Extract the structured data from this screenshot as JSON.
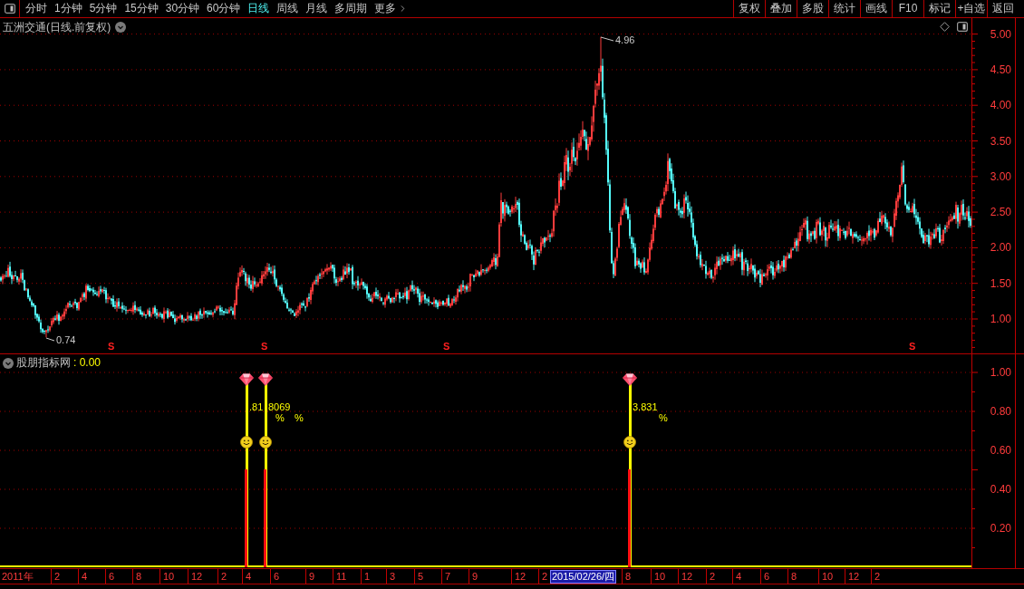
{
  "toolbar": {
    "periods": [
      {
        "label": "分时",
        "kind": "period",
        "selected": false
      },
      {
        "label": "1分钟",
        "kind": "period",
        "selected": false
      },
      {
        "label": "5分钟",
        "kind": "period",
        "selected": false
      },
      {
        "label": "15分钟",
        "kind": "period",
        "selected": false
      },
      {
        "label": "30分钟",
        "kind": "period",
        "selected": false
      },
      {
        "label": "60分钟",
        "kind": "period",
        "selected": false
      },
      {
        "label": "日线",
        "kind": "period",
        "selected": true
      },
      {
        "label": "周线",
        "kind": "period",
        "selected": false
      },
      {
        "label": "月线",
        "kind": "period",
        "selected": false
      },
      {
        "label": "多周期",
        "kind": "period",
        "selected": false
      },
      {
        "label": "更多",
        "kind": "menu",
        "selected": false
      }
    ],
    "actions": [
      "复权",
      "叠加",
      "多股",
      "统计",
      "画线",
      "F10",
      "标记",
      "+自选",
      "返回"
    ]
  },
  "price_panel": {
    "title": "五洲交通(日线.前复权)",
    "high_label": "4.96",
    "low_label": "0.74",
    "signals": [
      "S",
      "S",
      "S",
      "S"
    ],
    "axis_labels": [
      "5.00",
      "4.50",
      "4.00",
      "3.50",
      "3.00",
      "2.50",
      "2.00",
      "1.50",
      "1.00"
    ]
  },
  "indicator_panel": {
    "name": "股朋指标网",
    "reading": ": 0.00",
    "markers": [
      {
        "label": ".81",
        "unit": "%"
      },
      {
        "label": "8069",
        "unit": "%"
      },
      {
        "label": "3.831",
        "unit": "%"
      }
    ],
    "axis_labels": [
      "1.00",
      "0.80",
      "0.60",
      "0.40",
      "0.20"
    ]
  },
  "time_axis": [
    {
      "label": "2011年",
      "kind": "tick"
    },
    {
      "label": "2",
      "kind": "tick"
    },
    {
      "label": "4",
      "kind": "tick"
    },
    {
      "label": "6",
      "kind": "tick"
    },
    {
      "label": "8",
      "kind": "tick"
    },
    {
      "label": "10",
      "kind": "tick"
    },
    {
      "label": "12",
      "kind": "tick"
    },
    {
      "label": "2",
      "kind": "tick"
    },
    {
      "label": "4",
      "kind": "tick"
    },
    {
      "label": "6",
      "kind": "tick"
    },
    {
      "label": "9",
      "kind": "tick"
    },
    {
      "label": "11",
      "kind": "tick"
    },
    {
      "label": "1",
      "kind": "tick"
    },
    {
      "label": "3",
      "kind": "tick"
    },
    {
      "label": "5",
      "kind": "tick"
    },
    {
      "label": "7",
      "kind": "tick"
    },
    {
      "label": "9",
      "kind": "tick"
    },
    {
      "label": "12",
      "kind": "tick"
    },
    {
      "label": "2",
      "kind": "tick"
    },
    {
      "label": "2015/02/26/四",
      "kind": "cursor"
    },
    {
      "label": "8",
      "kind": "tick"
    },
    {
      "label": "10",
      "kind": "tick"
    },
    {
      "label": "12",
      "kind": "tick"
    },
    {
      "label": "2",
      "kind": "tick"
    },
    {
      "label": "4",
      "kind": "tick"
    },
    {
      "label": "6",
      "kind": "tick"
    },
    {
      "label": "8",
      "kind": "tick"
    },
    {
      "label": "10",
      "kind": "tick"
    },
    {
      "label": "12",
      "kind": "tick"
    },
    {
      "label": "2",
      "kind": "tick"
    }
  ]
}
